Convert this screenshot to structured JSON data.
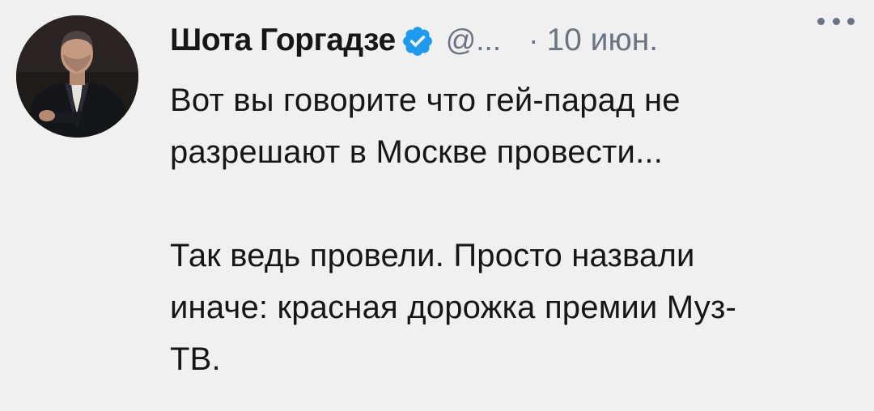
{
  "author": {
    "name": "Шота Горгадзе",
    "handle": "@...",
    "verified": true,
    "avatar": "person-in-dark-suit"
  },
  "meta": {
    "separator": "·",
    "timestamp": "10 июн."
  },
  "more": {
    "icon": "more-horizontal-icon"
  },
  "tweet": {
    "line1": "Вот вы говорите что гей-парад не",
    "line2": "разрешают в Москве провести...",
    "line3": "Так ведь провели. Просто назвали",
    "line4": "иначе: красная дорожка премии Муз-",
    "line5": "ТВ."
  },
  "colors": {
    "background": "#f0f0f0",
    "text": "#161616",
    "secondary": "#6b7480",
    "verified": "#1d9bf0"
  }
}
